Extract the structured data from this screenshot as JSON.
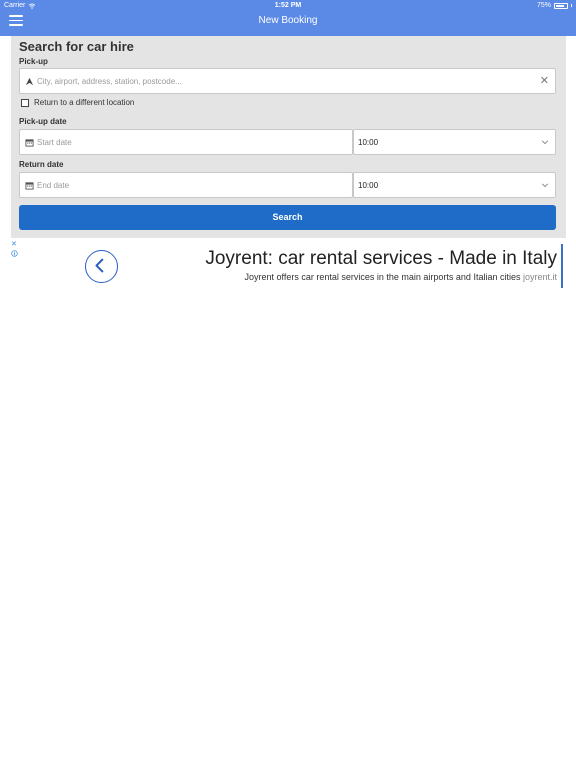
{
  "status_bar": {
    "carrier": "Carrier",
    "time": "1:52 PM",
    "battery": "75%",
    "battery_level": 0.75
  },
  "header": {
    "title": "New Booking",
    "menu_icon": "hamburger-menu-icon"
  },
  "form": {
    "title": "Search for car hire",
    "pickup_label": "Pick-up",
    "pickup_placeholder": "City, airport, address, station, postcode...",
    "return_checkbox_label": "Return to a different location",
    "return_checkbox_checked": false,
    "pickup_date_label": "Pick-up date",
    "start_date_placeholder": "Start date",
    "pickup_time": "10:00",
    "return_date_label": "Return date",
    "end_date_placeholder": "End date",
    "return_time": "10:00",
    "search_label": "Search"
  },
  "ad": {
    "title": "Joyrent: car rental services - Made in Italy",
    "description": "Joyrent offers car rental services in the main airports and Italian cities",
    "domain": "joyrent.it"
  },
  "colors": {
    "header": "#5b8ae6",
    "panel": "#e4e4e4",
    "button": "#1e6bc8",
    "ad_accent": "#2a5fc0"
  }
}
